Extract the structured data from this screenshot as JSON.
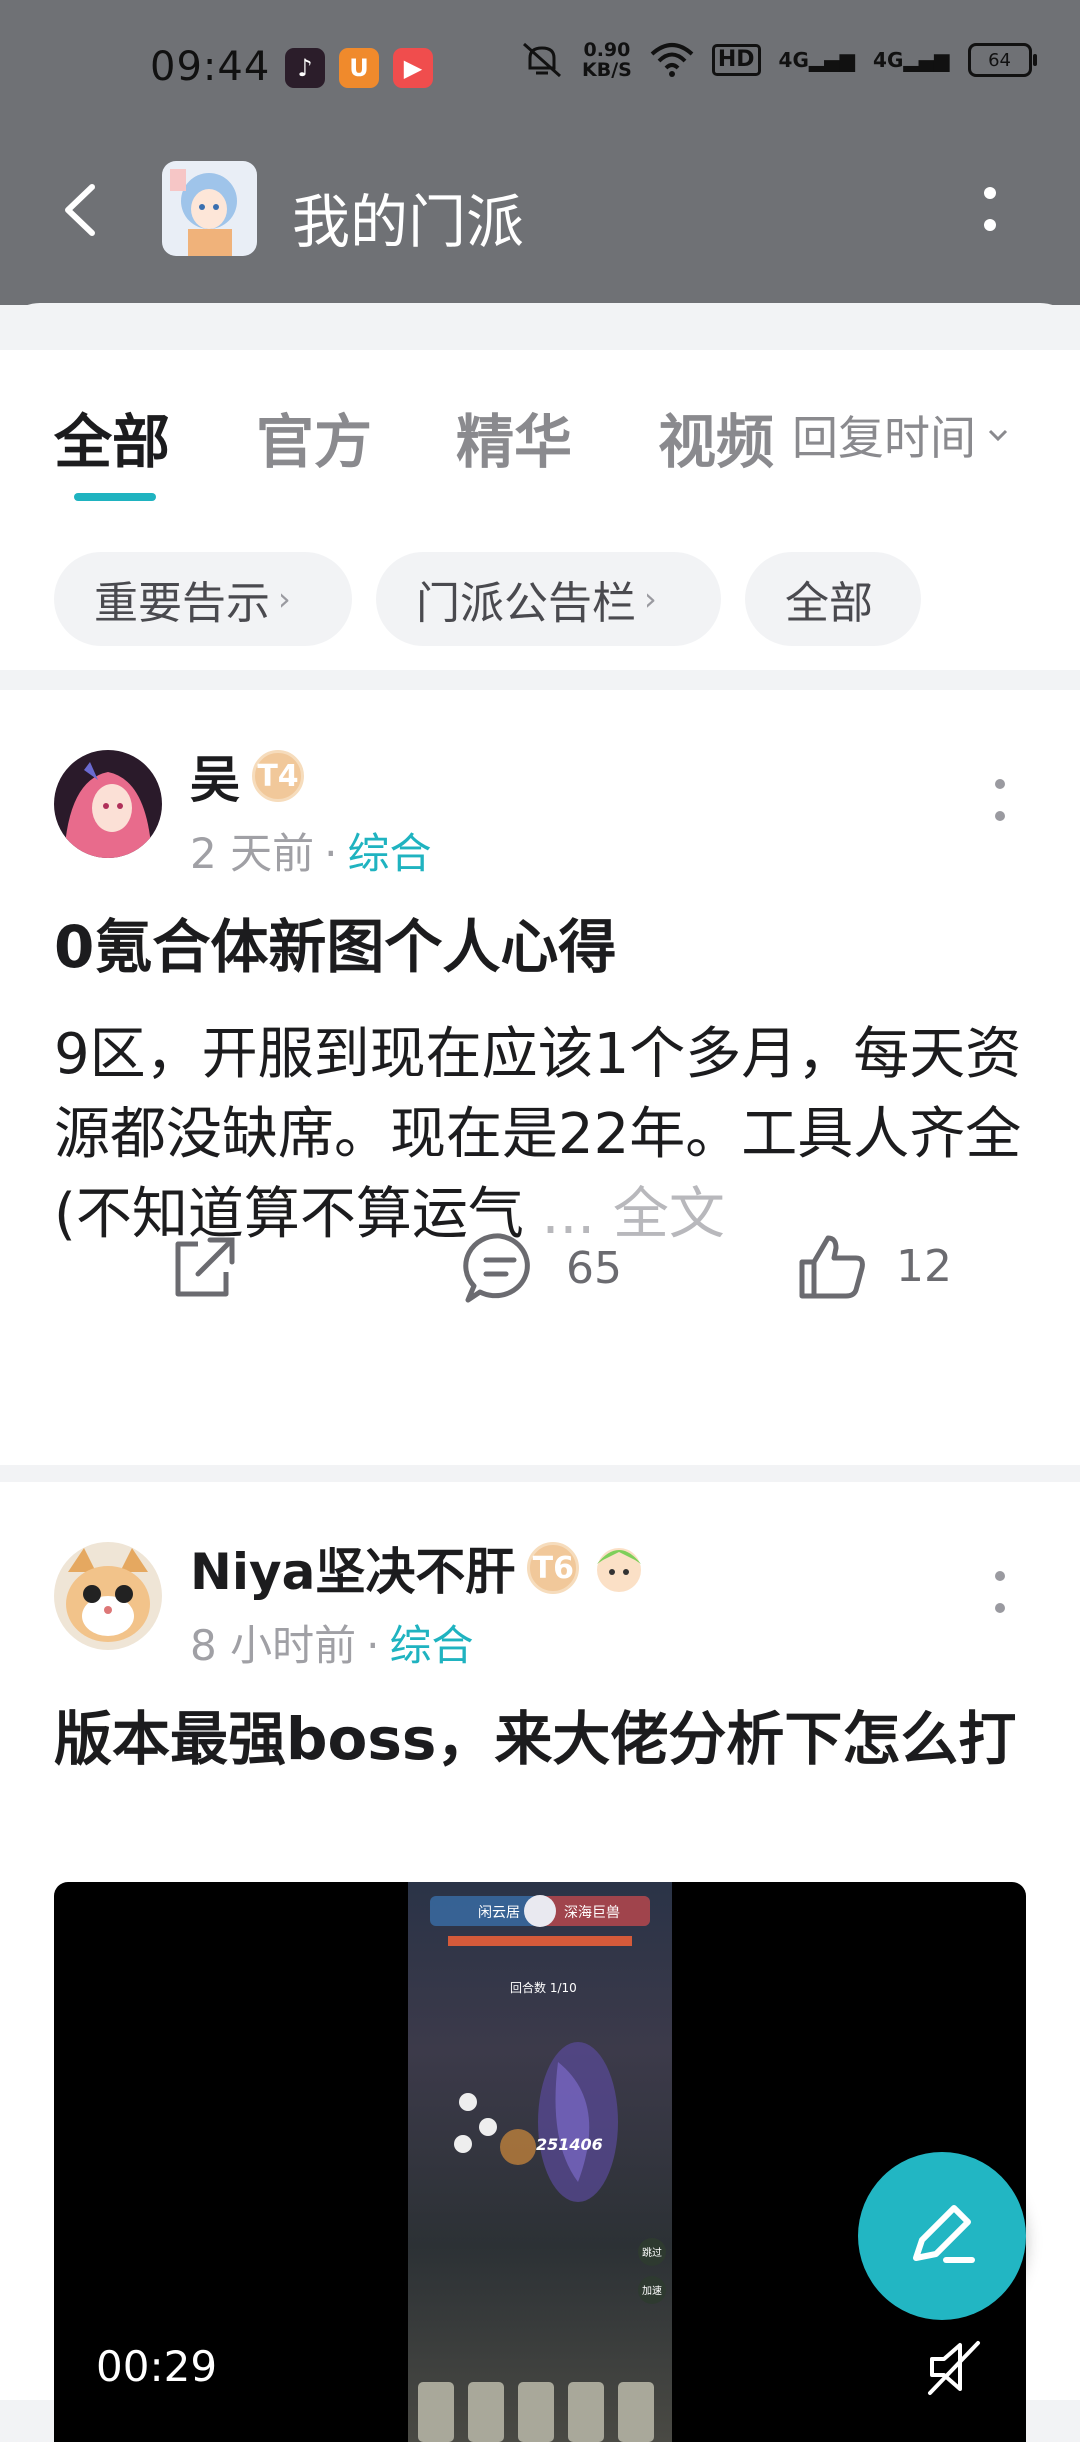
{
  "status_bar": {
    "time": "09:44",
    "speed_value": "0.90",
    "speed_unit": "KB/S",
    "hd_badge": "HD",
    "signal_1": "4G",
    "signal_2": "4G",
    "battery": "64",
    "app_icons": [
      "tiktok-icon",
      "uc-browser-icon",
      "video-app-icon"
    ]
  },
  "header": {
    "title": "我的门派",
    "back_icon": "chevron-left-icon",
    "more_icon": "more-vertical-icon"
  },
  "tabs": {
    "items": [
      {
        "label": "全部",
        "active": true
      },
      {
        "label": "官方",
        "active": false
      },
      {
        "label": "精华",
        "active": false
      },
      {
        "label": "视频",
        "active": false
      }
    ],
    "sort_label": "回复时间"
  },
  "chips": [
    {
      "label": "重要告示",
      "caret": "›"
    },
    {
      "label": "门派公告栏",
      "caret": "›"
    },
    {
      "label": "全部",
      "caret": ""
    }
  ],
  "posts": [
    {
      "author": "吴",
      "level_badge": "T4",
      "time": "2 天前",
      "separator": "·",
      "category": "综合",
      "title": "0氪合体新图个人心得",
      "body": "9区，开服到现在应该1个多月，每天资源都没缺席。现在是22年。工具人齐全(不知道算不算运气",
      "ellipsis": " ... ",
      "full_text_label": "全文",
      "comments": "65",
      "likes": "12"
    },
    {
      "author": "Niya坚决不肝",
      "level_badge": "T6",
      "time": "8 小时前",
      "separator": "·",
      "category": "综合",
      "title": "版本最强boss，来大佬分析下怎么打",
      "video_duration": "00:29",
      "video_overlay_text": {
        "team_left": "闲云居",
        "team_right": "深海巨兽",
        "round": "回合数 1/10",
        "damage": "251406",
        "skip": "跳过",
        "speed": "加速"
      }
    }
  ],
  "colors": {
    "accent": "#1fb3c0",
    "header_bg": "#6f7175",
    "fab": "#22b6c3"
  }
}
